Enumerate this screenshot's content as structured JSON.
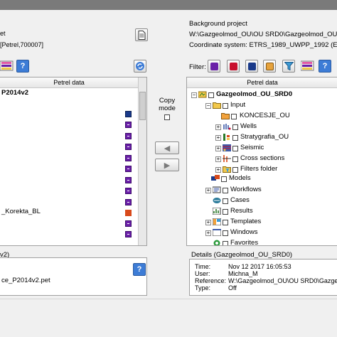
{
  "left": {
    "header_line1": "et",
    "header_line2": "[Petrel,700007]",
    "column_header": "Petrel data",
    "tree_root": "P2014v2",
    "item_korekta": "_Korekta_BL",
    "details_line1": "v2)",
    "details_line2": "ce_P2014v2.pet"
  },
  "copy_mode": {
    "label_line1": "Copy",
    "label_line2": "mode"
  },
  "right": {
    "background_project_label": "Background project",
    "project_path": "W:\\Gazgeolmod_OU\\OU SRD0\\Gazgeolmod_OU_SRD",
    "coordinate_system": "Coordinate system:  ETRS_1989_UWPP_1992 (ETRS",
    "filter_label": "Filter:",
    "column_header": "Petrel data",
    "tree": [
      {
        "label": "Gazgeolmod_OU_SRD0",
        "bold": true
      },
      {
        "label": "Input"
      },
      {
        "label": "KONCESJE_OU"
      },
      {
        "label": "Wells"
      },
      {
        "label": "Stratygrafia_OU"
      },
      {
        "label": "Seismic"
      },
      {
        "label": "Cross sections"
      },
      {
        "label": "Filters folder"
      },
      {
        "label": "Models"
      },
      {
        "label": "Workflows"
      },
      {
        "label": "Cases"
      },
      {
        "label": "Results"
      },
      {
        "label": "Templates"
      },
      {
        "label": "Windows"
      },
      {
        "label": "Favorites"
      }
    ],
    "details": {
      "title": "Details (Gazgeolmod_OU_SRD0)",
      "time_label": "Time:",
      "time_value": "Nov 12 2017 16:05:53",
      "user_label": "User:",
      "user_value": "Michna_M",
      "reference_label": "Reference:",
      "reference_value": "W:\\Gazgeolmod_OU\\OU SRD0\\Gazgeolm",
      "type_label": "Type:",
      "type_value": "Off"
    }
  },
  "icons": {
    "document": "document-icon",
    "help": "help-icon",
    "refresh": "refresh-icon",
    "arrow_left": "arrow-left-icon",
    "arrow_right": "arrow-right-icon",
    "filter": "filter-icon"
  },
  "colors": {
    "accent_purple": "#6a1fa8",
    "help_blue": "#3d7cd6",
    "folder_yellow": "#f2c84b"
  }
}
